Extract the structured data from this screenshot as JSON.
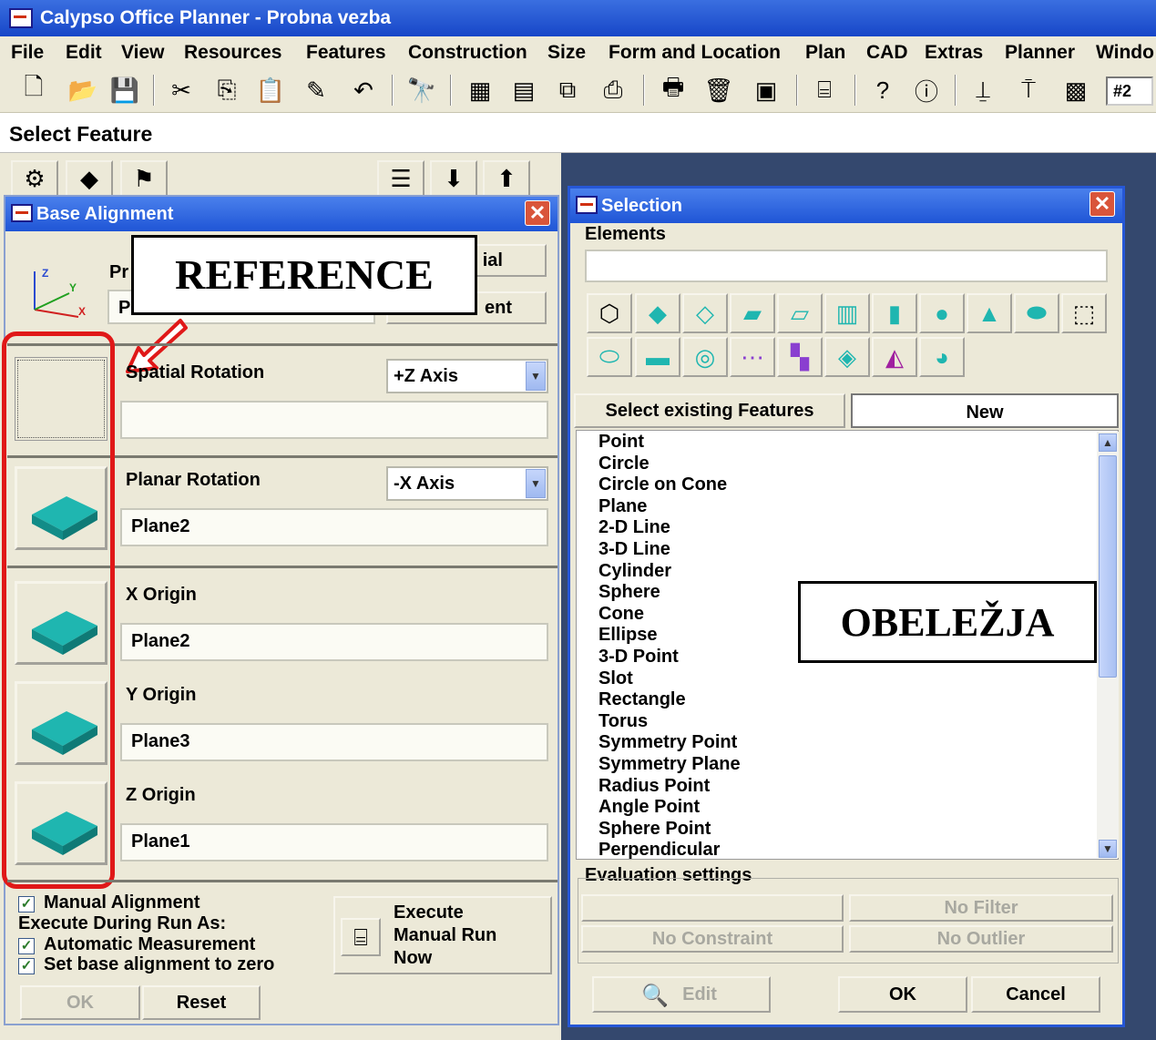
{
  "window": {
    "title": "Calypso Office Planner - Probna vezba"
  },
  "menu": [
    "File",
    "Edit",
    "View",
    "Resources",
    "Features",
    "Construction",
    "Size",
    "Form and Location",
    "Plan",
    "CAD",
    "Extras",
    "Planner",
    "Windo"
  ],
  "toolbar": {
    "zoom_label": "#2"
  },
  "status": {
    "prompt": "Select Feature"
  },
  "base_alignment": {
    "title": "Base Alignment",
    "annotation": "REFERENCE",
    "partial_texts": {
      "primary_label": "Pr",
      "primary_value": "P",
      "button1": "ial",
      "button2": "ent"
    },
    "spatial_rotation": {
      "label": "Spatial Rotation",
      "axis": "+Z Axis",
      "value": ""
    },
    "planar_rotation": {
      "label": "Planar Rotation",
      "axis": "-X Axis",
      "value": "Plane2"
    },
    "x_origin": {
      "label": "X Origin",
      "value": "Plane2"
    },
    "y_origin": {
      "label": "Y Origin",
      "value": "Plane3"
    },
    "z_origin": {
      "label": "Z Origin",
      "value": "Plane1"
    },
    "manual_alignment": "Manual Alignment",
    "execute_during": "Execute During Run As:",
    "automatic_measurement": "Automatic Measurement",
    "set_zero": "Set base alignment to zero",
    "execute_button": [
      "Execute",
      "Manual Run",
      "Now"
    ],
    "ok": "OK",
    "reset": "Reset"
  },
  "selection": {
    "title": "Selection",
    "elements_label": "Elements",
    "elements_value": "",
    "tab_existing": "Select existing Features",
    "tab_new": "New",
    "annotation": "OBELEŽJA",
    "features": [
      "Point",
      "Circle",
      "Circle on Cone",
      "Plane",
      "2-D Line",
      "3-D Line",
      "Cylinder",
      "Sphere",
      "Cone",
      "Ellipse",
      "3-D Point",
      "Slot",
      "Rectangle",
      "Torus",
      "Symmetry Point",
      "Symmetry Plane",
      "Radius Point",
      "Angle Point",
      "Sphere Point",
      "Perpendicular"
    ],
    "evaluation_label": "Evaluation settings",
    "no_filter": "No Filter",
    "no_constraint": "No Constraint",
    "no_outlier": "No Outlier",
    "edit": "Edit",
    "ok": "OK",
    "cancel": "Cancel"
  },
  "colors": {
    "title_blue": "#1f55d6",
    "feature_teal": "#1fb6b0",
    "annotation_red": "#e01818",
    "dialog_bg": "#ece9d8"
  }
}
